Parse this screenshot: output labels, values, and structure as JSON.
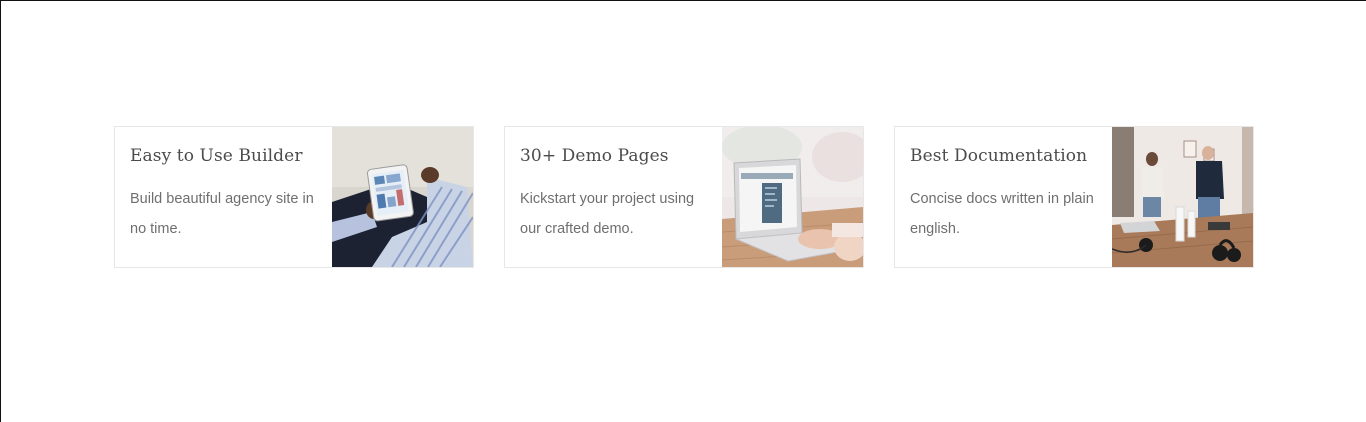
{
  "features": [
    {
      "title": "Easy to Use Builder",
      "description": "Build beautiful agency site in no time."
    },
    {
      "title": "30+ Demo Pages",
      "description": "Kickstart your project using our crafted demo."
    },
    {
      "title": "Best Documentation",
      "description": "Concise docs written in plain english."
    }
  ]
}
